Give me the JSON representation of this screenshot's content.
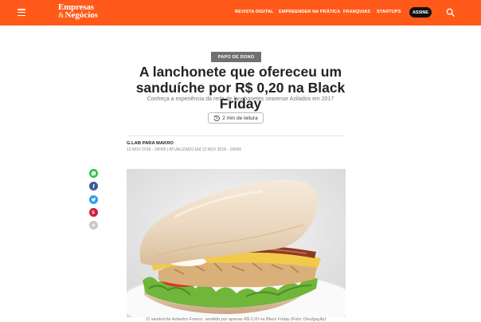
{
  "header": {
    "logo_line1": "Empresas",
    "logo_amp": "&",
    "logo_line2": "Negócios",
    "nav": [
      "REVISTA DIGITAL",
      "EMPREENDER NA PRÁTICA",
      "FRANQUIAS",
      "STARTUPS"
    ],
    "subscribe_label": "ASSINE",
    "brand_color": "#ff5a19"
  },
  "article": {
    "tag": "PAPO DE DONO",
    "title": "A lanchonete que ofereceu um sanduíche por R$ 0,20 na Black Friday",
    "subtitle": "Conheça a experiência da rede de lanchonetes cearense Azilados em 2017",
    "read_time": "2 min de leitura",
    "author": "G.LAB PARA MAKRO",
    "dates": "12 NOV 2018 - 10H05 | ATUALIZADO EM 12 NOV 2018 - 10H06",
    "photo_caption": "O sanduíche Azilados Franco, vendido por apenas R$ 0,20 na Black Friday (Foto: Divulgação)"
  },
  "share": {
    "icons": [
      "whatsapp-icon",
      "facebook-icon",
      "twitter-icon",
      "pinterest-icon",
      "plus-icon"
    ]
  }
}
